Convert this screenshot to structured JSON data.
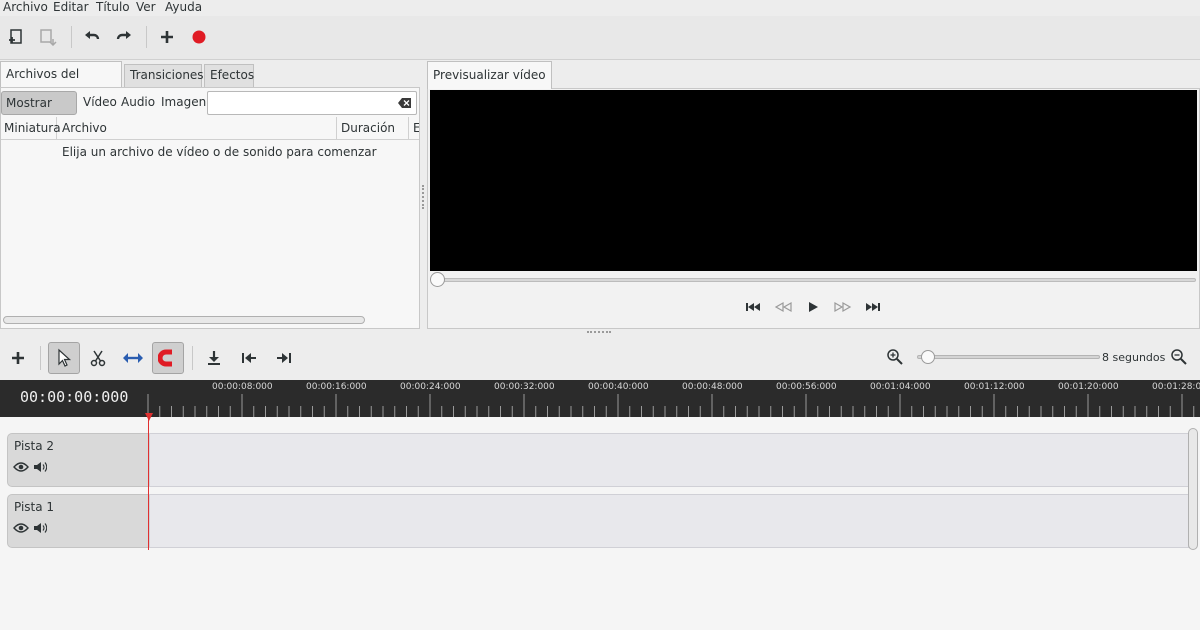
{
  "menubar": {
    "items": [
      "Archivo",
      "Editar",
      "Título",
      "Ver",
      "Ayuda"
    ]
  },
  "toolbar": {
    "buttons": [
      "import-files-icon",
      "export-icon",
      "undo-icon",
      "redo-icon",
      "add-icon",
      "record-icon"
    ]
  },
  "left_panel": {
    "tabs": [
      "Archivos del proyecto",
      "Transiciones",
      "Efectos"
    ],
    "filters": [
      "Mostrar todo",
      "Vídeo",
      "Audio",
      "Imagen"
    ],
    "search_value": "",
    "columns": [
      "Miniatura",
      "Archivo",
      "Duración",
      "E"
    ],
    "empty_message": "Elija un archivo de vídeo o de sonido para comenzar"
  },
  "preview": {
    "tab_label": "Previsualizar vídeo",
    "seek_fraction": 0
  },
  "timeline": {
    "zoom_label": "8 segundos",
    "timecode": "00:00:00:000",
    "ruler_labels": [
      "00:00:08:000",
      "00:00:16:000",
      "00:00:24:000",
      "00:00:32:000",
      "00:00:40:000",
      "00:00:48:000",
      "00:00:56:000",
      "00:01:04:000",
      "00:01:12:000",
      "00:01:20:000",
      "00:01:28:0"
    ],
    "tracks": [
      {
        "name": "Pista 2"
      },
      {
        "name": "Pista 1"
      }
    ]
  },
  "colors": {
    "accent_record": "#e01b24",
    "playhead": "#e03030",
    "ruler_bg": "#2b2b2b"
  }
}
